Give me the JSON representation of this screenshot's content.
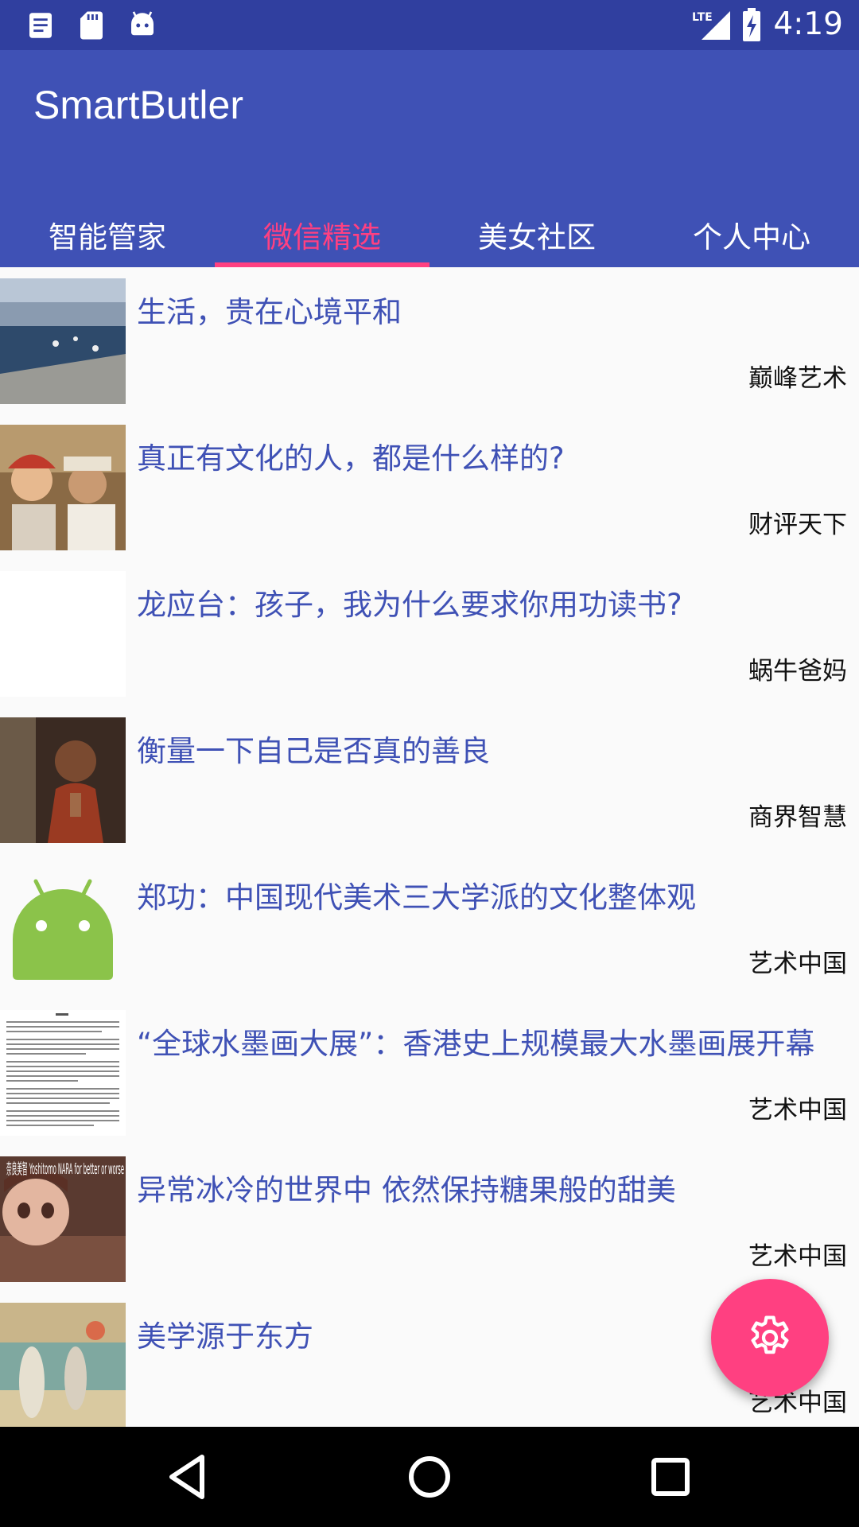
{
  "status_bar": {
    "time": "4:19",
    "network": "LTE",
    "left_icons": [
      "notes-icon",
      "sd-card-icon",
      "android-debug-icon"
    ]
  },
  "app": {
    "title": "SmartButler"
  },
  "tabs": [
    {
      "label": "智能管家",
      "active": false
    },
    {
      "label": "微信精选",
      "active": true
    },
    {
      "label": "美女社区",
      "active": false
    },
    {
      "label": "个人中心",
      "active": false
    }
  ],
  "articles": [
    {
      "title": "生活，贵在心境平和",
      "source": "巅峰艺术"
    },
    {
      "title": "真正有文化的人，都是什么样的?",
      "source": "财评天下"
    },
    {
      "title": "龙应台：孩子，我为什么要求你用功读书?",
      "source": "蜗牛爸妈"
    },
    {
      "title": "衡量一下自己是否真的善良",
      "source": "商界智慧"
    },
    {
      "title": "郑功：中国现代美术三大学派的文化整体观",
      "source": "艺术中国"
    },
    {
      "title": "“全球水墨画大展”：香港史上规模最大水墨画展开幕",
      "source": "艺术中国"
    },
    {
      "title": "异常冰冷的世界中 依然保持糖果般的甜美",
      "source": "艺术中国"
    },
    {
      "title": "美学源于东方",
      "source": "艺术中国"
    }
  ],
  "thumb7_text": "奈良美智 Yoshitomo NARA for better or worse",
  "fab_icon": "settings-gear-icon",
  "colors": {
    "primary": "#3f51b5",
    "primary_dark": "#303f9f",
    "accent": "#ff4081"
  }
}
